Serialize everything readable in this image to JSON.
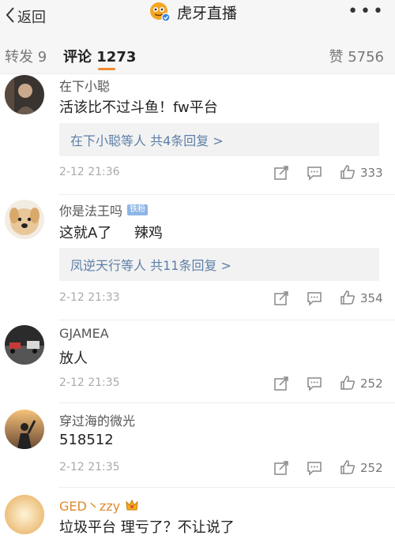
{
  "header": {
    "back_label": "返回",
    "title": "虎牙直播",
    "more_label": "•••"
  },
  "tabs": {
    "repost": "转发 9",
    "comment": "评论 1273",
    "like": "赞 5756"
  },
  "colors": {
    "accent": "#f0882e",
    "link": "#5d7fa8",
    "gold_name": "#e08a2a"
  },
  "comments": [
    {
      "user": "在下小聪",
      "text": "活该比不过斗鱼！fw平台",
      "replies": "在下小聪等人  共4条回复 >",
      "time": "2-12 21:36",
      "likes": "333"
    },
    {
      "user": "你是法王吗",
      "badge": "铁粉",
      "text": "这就A了     辣鸡",
      "replies": "凤逆天行等人  共11条回复 >",
      "time": "2-12 21:33",
      "likes": "354"
    },
    {
      "user": "GJAMEA",
      "text": "放人",
      "time": "2-12 21:35",
      "likes": "252"
    },
    {
      "user": "穿过海的微光",
      "text": "518512",
      "time": "2-12 21:35",
      "likes": "252"
    },
    {
      "user": "GED丶zzy",
      "text": "垃圾平台 理亏了？不让说了"
    }
  ]
}
